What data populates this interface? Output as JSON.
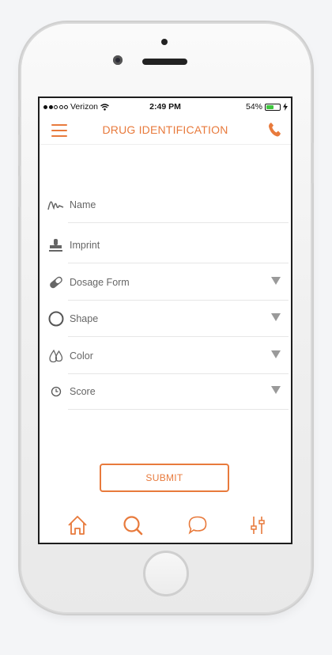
{
  "status_bar": {
    "carrier": "Verizon",
    "time": "2:49 PM",
    "battery": "54%",
    "battery_level": 0.54,
    "signal_bars_filled": 2,
    "signal_bars_total": 5
  },
  "header": {
    "title": "DRUG IDENTIFICATION",
    "menu_icon": "hamburger-menu-icon",
    "call_icon": "phone-icon",
    "accent_color": "#e87a3c"
  },
  "form": {
    "fields": [
      {
        "label": "Name",
        "icon": "signature-icon",
        "has_dropdown": false
      },
      {
        "label": "Imprint",
        "icon": "stamp-icon",
        "has_dropdown": false
      },
      {
        "label": "Dosage Form",
        "icon": "pill-icon",
        "has_dropdown": true
      },
      {
        "label": "Shape",
        "icon": "circle-shape-icon",
        "has_dropdown": true
      },
      {
        "label": "Color",
        "icon": "drops-icon",
        "has_dropdown": true
      },
      {
        "label": "Score",
        "icon": "score-icon",
        "has_dropdown": true
      }
    ],
    "submit_label": "SUBMIT"
  },
  "tabbar": {
    "items": [
      "home-icon",
      "search-icon",
      "chat-icon",
      "settings-sliders-icon"
    ],
    "active": "search-icon"
  }
}
